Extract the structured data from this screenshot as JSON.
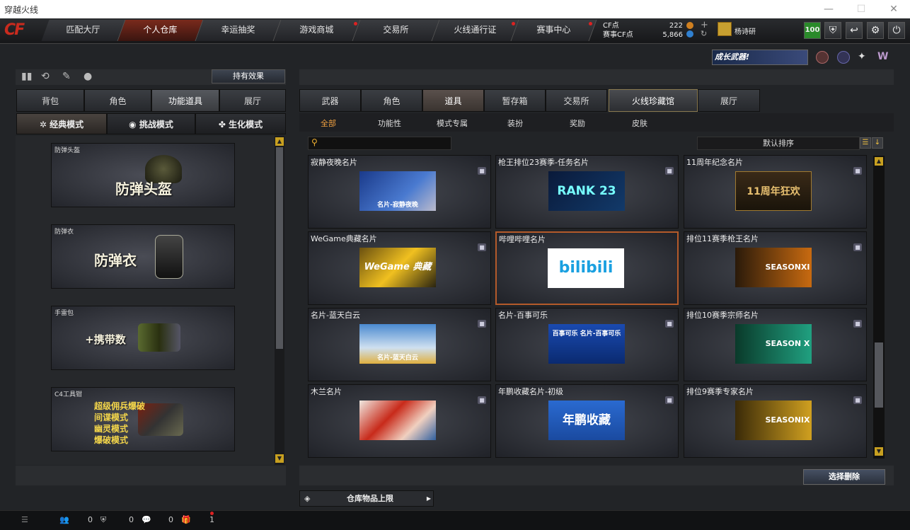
{
  "window": {
    "title": "穿越火线"
  },
  "nav": {
    "tabs": [
      "匹配大厅",
      "个人仓库",
      "幸运抽奖",
      "游戏商城",
      "交易所",
      "火线通行证",
      "赛事中心"
    ],
    "logo": "CF"
  },
  "currency": {
    "cf_label": "CF点",
    "cf_value": "222",
    "event_label": "赛事CF点",
    "event_value": "5,866"
  },
  "user": {
    "name": "杨诗研",
    "level": "100"
  },
  "banner": {
    "text": "成长武器!"
  },
  "left": {
    "hold_effect": "持有效果",
    "tabs": [
      "背包",
      "角色",
      "功能道具",
      "展厅"
    ],
    "modes": [
      "经典模式",
      "挑战模式",
      "生化模式"
    ],
    "cards": [
      {
        "label": "防弹头盔",
        "text": "防弹头盔"
      },
      {
        "label": "防弹衣",
        "text": "防弹衣"
      },
      {
        "label": "手雷包",
        "text": "+携带数"
      },
      {
        "label": "C4工具钳",
        "lines": [
          "超级佣兵爆破",
          "间谍模式",
          "幽灵模式",
          "爆破模式"
        ]
      }
    ]
  },
  "right": {
    "tabs": [
      "武器",
      "角色",
      "道具",
      "暂存箱",
      "交易所",
      "火线珍藏馆",
      "展厅"
    ],
    "subtabs": [
      "全部",
      "功能性",
      "模式专属",
      "装扮",
      "奖励",
      "皮肤"
    ],
    "sort": "默认排序",
    "cards": [
      {
        "name": "寂静夜晚名片",
        "img_text": "名片-寂静夜晚"
      },
      {
        "name": "枪王排位23赛季-任务名片",
        "img_text": "RANK 23"
      },
      {
        "name": "11周年纪念名片",
        "img_text": "11周年狂欢"
      },
      {
        "name": "WeGame典藏名片",
        "img_text": "WeGame 典藏"
      },
      {
        "name": "哔哩哔哩名片",
        "img_text": "bilibili"
      },
      {
        "name": "排位11赛季枪王名片",
        "img_text": "SEASONXI"
      },
      {
        "name": "名片-蓝天白云",
        "img_text": "名片-蓝天白云"
      },
      {
        "name": "名片-百事可乐",
        "img_text": "百事可乐 名片-百事可乐"
      },
      {
        "name": "排位10赛季宗师名片",
        "img_text": "SEASON X"
      },
      {
        "name": "木兰名片",
        "img_text": ""
      },
      {
        "name": "年鹏收藏名片-初级",
        "img_text": "年鹏收藏"
      },
      {
        "name": "排位9赛季专家名片",
        "img_text": "SEASONIX"
      }
    ],
    "delete_button": "选择删除",
    "storage": "仓库物品上限"
  },
  "status": {
    "friends": "0",
    "shield": "0",
    "chat": "0",
    "gift": "1"
  }
}
